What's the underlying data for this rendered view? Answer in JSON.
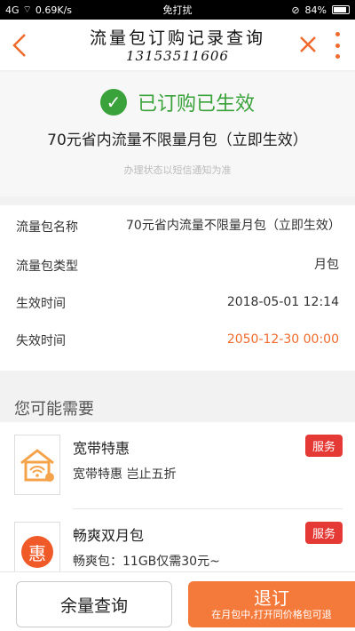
{
  "status_bar": {
    "network": "4G",
    "speed": "0.69K/s",
    "center_text": "免打扰",
    "battery": "84%"
  },
  "header": {
    "title": "流量包订购记录查询",
    "phone": "13153511606"
  },
  "status": {
    "text": "已订购已生效",
    "package": "70元省内流量不限量月包（立即生效）",
    "note": "办理状态以短信通知为准"
  },
  "details": [
    {
      "label": "流量包名称",
      "value": "70元省内流量不限量月包（立即生效）"
    },
    {
      "label": "流量包类型",
      "value": "月包"
    },
    {
      "label": "生效时间",
      "value": "2018-05-01 12:14"
    },
    {
      "label": "失效时间",
      "value": "2050-12-30 00:00"
    }
  ],
  "recommend": {
    "header": "您可能需要",
    "items": [
      {
        "name": "宽带特惠",
        "desc": "宽带特惠 岂止五折",
        "tag": "服务"
      },
      {
        "name": "畅爽双月包",
        "desc": "畅爽包：11GB仅需30元~",
        "tag": "服务",
        "icon_char": "惠"
      }
    ]
  },
  "bottom": {
    "query_label": "余量查询",
    "unsub_label": "退订",
    "unsub_sub": "在月包中,打开同价格包可退"
  },
  "colors": {
    "accent": "#f06a2c",
    "success": "#3aa23a",
    "tag_red": "#e53935"
  }
}
